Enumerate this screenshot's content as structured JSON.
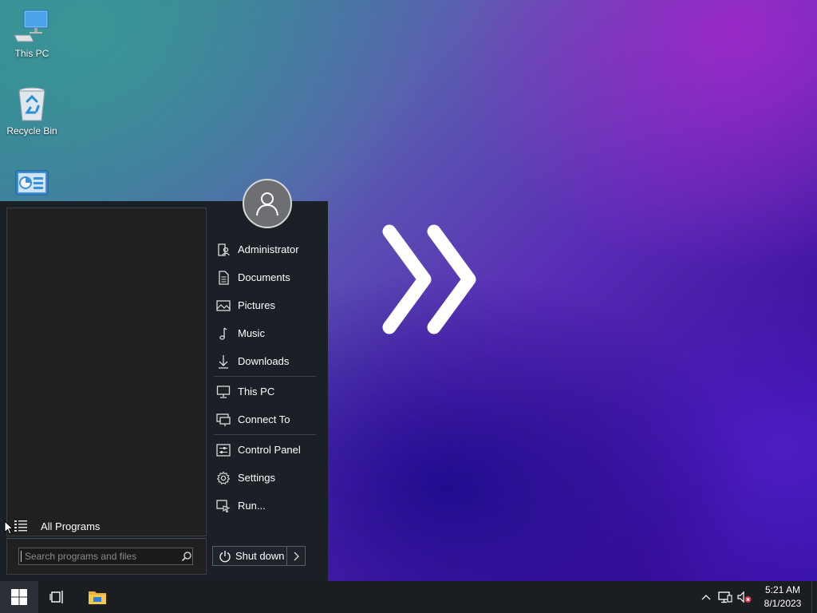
{
  "desktop": {
    "icons": [
      {
        "label": "This PC",
        "icon": "computer-icon"
      },
      {
        "label": "Recycle Bin",
        "icon": "recycle-bin-icon"
      },
      {
        "label": "",
        "icon": "control-panel-icon"
      }
    ]
  },
  "start_menu": {
    "all_programs": "All Programs",
    "search": {
      "placeholder": "Search programs and files",
      "value": ""
    },
    "user_avatar": "user-avatar-icon",
    "items": [
      {
        "label": "Administrator",
        "icon": "user-folder-icon"
      },
      {
        "label": "Documents",
        "icon": "document-icon"
      },
      {
        "label": "Pictures",
        "icon": "picture-icon"
      },
      {
        "label": "Music",
        "icon": "music-note-icon"
      },
      {
        "label": "Downloads",
        "icon": "download-arrow-icon"
      },
      {
        "label": "This PC",
        "icon": "monitor-icon"
      },
      {
        "label": "Connect To",
        "icon": "network-connect-icon"
      },
      {
        "label": "Control Panel",
        "icon": "control-panel-icon"
      },
      {
        "label": "Settings",
        "icon": "gear-icon"
      },
      {
        "label": "Run...",
        "icon": "run-icon"
      }
    ],
    "shutdown_label": "Shut down"
  },
  "taskbar": {
    "start_icon": "windows-logo-icon",
    "task_view_icon": "task-view-icon",
    "explorer_icon": "file-explorer-icon",
    "tray": {
      "time": "5:21 AM",
      "date": "8/1/2023"
    }
  },
  "colors": {
    "menu_bg": "#1b1f26",
    "pane_bg": "#202020",
    "taskbar_bg": "#1a1d22",
    "folder_yellow": "#f0c040"
  }
}
